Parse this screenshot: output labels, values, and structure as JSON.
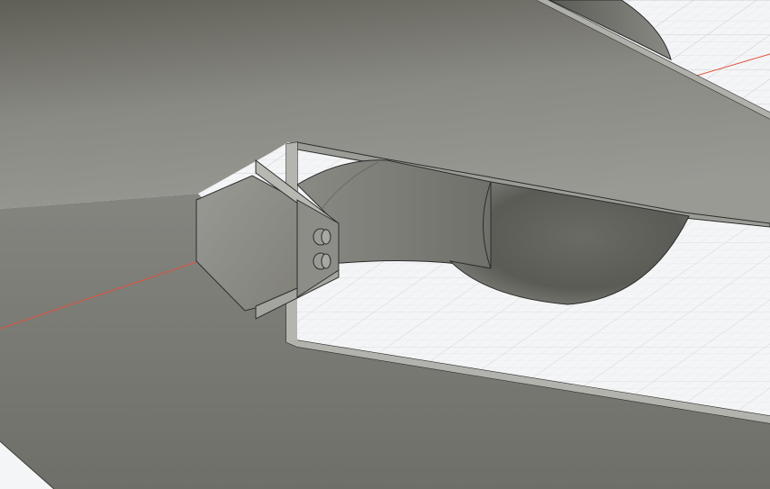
{
  "viewport": {
    "background": "#f4f5f6",
    "grid_major_color": "#c9cdd1",
    "grid_minor_color": "#e3e6e8",
    "axis_x_color": "#e0503c",
    "model_edge_color": "#2b2b2b",
    "body_color": "#8f8f8a"
  }
}
